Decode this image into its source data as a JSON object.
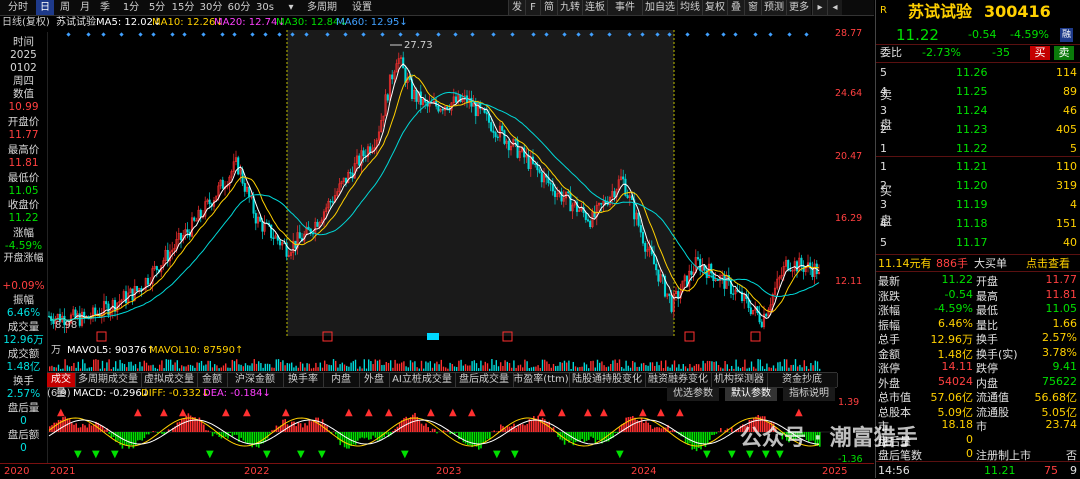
{
  "toolbar": {
    "periods": [
      "分时",
      "日",
      "周",
      "月",
      "季",
      "1分",
      "5分",
      "15分",
      "30分",
      "60分",
      "30s"
    ],
    "active_period": "日",
    "extra": [
      "多周期",
      "设置"
    ],
    "right_buttons": [
      "发",
      "F",
      "简",
      "九转",
      "连板",
      "事件",
      "加自选",
      "均线",
      "复权",
      "叠",
      "窗",
      "预测",
      "更多"
    ]
  },
  "ma_bar": {
    "label": "日线(复权)",
    "name": "苏试试验",
    "ma5": "MA5: 12.02↓",
    "ma10": "MA10: 12.26↓",
    "ma20": "MA20: 12.74↓",
    "ma30": "MA30: 12.84↓",
    "ma60": "MA60: 12.95↓"
  },
  "left_info": {
    "time_label": "时间",
    "year": "2025",
    "date": "0102",
    "weekday": "周四",
    "value_label": "数值",
    "value": "10.99",
    "open_label": "开盘价",
    "open": "11.77",
    "high_label": "最高价",
    "high": "11.81",
    "low_label": "最低价",
    "low": "11.05",
    "close_label": "收盘价",
    "close": "11.22",
    "change_label": "涨幅",
    "change": "-4.59%",
    "open_change_label": "开盘涨幅",
    "open_change": "+0.09%",
    "amplitude_label": "振幅",
    "amplitude": "6.46%",
    "volume_label": "成交量",
    "volume": "12.96万",
    "amount_label": "成交额",
    "amount": "1.48亿",
    "turnover_label": "换手",
    "turnover": "2.57%",
    "post_vol_label": "盘后量",
    "post_vol": "0",
    "post_amt_label": "盘后额",
    "post_amt": "0"
  },
  "price_axis": [
    "28.77",
    "24.64",
    "20.47",
    "16.29",
    "12.11"
  ],
  "main_annotations": {
    "high": "27.73",
    "low": "8.98"
  },
  "volume_bar": {
    "unit": "万",
    "mavol5": "MAVOL5: 90376↑",
    "mavol10": "MAVOL10: 87590↑"
  },
  "indicator_tabs": [
    "成交量",
    "多周期成交量",
    "虚拟成交量",
    "金额",
    "沪深金额",
    "换手率",
    "内盘",
    "外盘",
    "AI立桩成交量",
    "盘后成交量",
    "市盈率(ttm)",
    "陆股通持股变化",
    "融资融券变化",
    "机构探测器",
    "资金抄底"
  ],
  "macd_bar": {
    "params": "(6,9)",
    "macd": "MACD: -0.296↓",
    "diff": "DIFF: -0.332↓",
    "dea": "DEA: -0.184↓",
    "btn_opt": "优选参数",
    "btn_default": "默认参数",
    "btn_help": "指标说明",
    "axis_top": "1.39",
    "axis_bottom": "-1.36"
  },
  "x_axis": [
    "2020",
    "2021",
    "2022",
    "2023",
    "2024",
    "2025"
  ],
  "quote": {
    "market": "R",
    "name": "苏试试验",
    "code": "300416",
    "price": "11.22",
    "change": "-0.54",
    "change_pct": "-4.59%",
    "ratio_label": "委比",
    "ratio": "-2.73%",
    "ratio_diff": "-35",
    "buy_btn": "买",
    "sell_btn": "卖",
    "sell_side_label": [
      "卖",
      "盘"
    ],
    "buy_side_label": [
      "买",
      "盘"
    ],
    "asks": [
      {
        "level": "5",
        "price": "11.26",
        "vol": "114"
      },
      {
        "level": "4",
        "price": "11.25",
        "vol": "89"
      },
      {
        "level": "3",
        "price": "11.24",
        "vol": "46"
      },
      {
        "level": "2",
        "price": "11.23",
        "vol": "405"
      },
      {
        "level": "1",
        "price": "11.22",
        "vol": "5"
      }
    ],
    "bids": [
      {
        "level": "1",
        "price": "11.21",
        "vol": "110"
      },
      {
        "level": "2",
        "price": "11.20",
        "vol": "319"
      },
      {
        "level": "3",
        "price": "11.19",
        "vol": "4"
      },
      {
        "level": "4",
        "price": "11.18",
        "vol": "151"
      },
      {
        "level": "5",
        "price": "11.17",
        "vol": "40"
      }
    ],
    "big_order": {
      "price": "11.14元有",
      "qty": "886手",
      "type": "大买单",
      "action": "点击查看"
    },
    "stats": [
      {
        "l1": "最新",
        "v1": "11.22",
        "c1": "green",
        "l2": "开盘",
        "v2": "11.77",
        "c2": "red"
      },
      {
        "l1": "涨跌",
        "v1": "-0.54",
        "c1": "green",
        "l2": "最高",
        "v2": "11.81",
        "c2": "red"
      },
      {
        "l1": "涨幅",
        "v1": "-4.59%",
        "c1": "green",
        "l2": "最低",
        "v2": "11.05",
        "c2": "green"
      },
      {
        "l1": "振幅",
        "v1": "6.46%",
        "c1": "yellow",
        "l2": "量比",
        "v2": "1.66",
        "c2": "yellow"
      },
      {
        "l1": "总手",
        "v1": "12.96万",
        "c1": "yellow",
        "l2": "换手",
        "v2": "2.57%",
        "c2": "yellow"
      },
      {
        "l1": "金额",
        "v1": "1.48亿",
        "c1": "yellow",
        "l2": "换手(实)",
        "v2": "3.78%",
        "c2": "yellow"
      },
      {
        "l1": "涨停",
        "v1": "14.11",
        "c1": "red",
        "l2": "跌停",
        "v2": "9.41",
        "c2": "green"
      },
      {
        "l1": "外盘",
        "v1": "54024",
        "c1": "red",
        "l2": "内盘",
        "v2": "75622",
        "c2": "green"
      },
      {
        "l1": "总市值",
        "v1": "57.06亿",
        "c1": "yellow",
        "l2": "流通值",
        "v2": "56.68亿",
        "c2": "yellow"
      },
      {
        "l1": "总股本",
        "v1": "5.09亿",
        "c1": "yellow",
        "l2": "流通股",
        "v2": "5.05亿",
        "c2": "yellow"
      },
      {
        "l1": "市",
        "v1": "18.18",
        "c1": "yellow",
        "l2": "市",
        "v2": "23.74",
        "c2": "yellow"
      },
      {
        "l1": "盘后量",
        "v1": "0",
        "c1": "yellow",
        "l2": "",
        "v2": "",
        "c2": "yellow"
      },
      {
        "l1": "盘后笔数",
        "v1": "0",
        "c1": "yellow",
        "l2": "注册制上市",
        "v2": "否",
        "c2": "white"
      }
    ],
    "tick": {
      "time": "14:56",
      "price": "11.21",
      "vol": "75",
      "count": "9"
    }
  },
  "watermark": "公众号 · 潮富猎手"
}
